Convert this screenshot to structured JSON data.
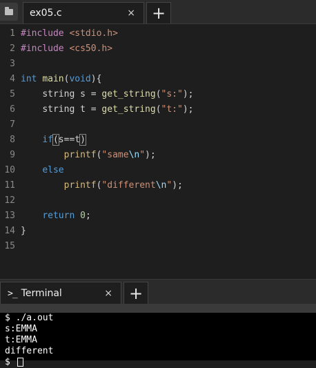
{
  "editor": {
    "tab_label": "ex05.c",
    "close_glyph": "×",
    "add_tab_glyph": "+"
  },
  "code_lines": [
    {
      "n": "1"
    },
    {
      "n": "2"
    },
    {
      "n": "3"
    },
    {
      "n": "4"
    },
    {
      "n": "5"
    },
    {
      "n": "6"
    },
    {
      "n": "7"
    },
    {
      "n": "8"
    },
    {
      "n": "9"
    },
    {
      "n": "10"
    },
    {
      "n": "11"
    },
    {
      "n": "12"
    },
    {
      "n": "13"
    },
    {
      "n": "14"
    },
    {
      "n": "15"
    }
  ],
  "code": {
    "l1_dir": "#include",
    "l1_hdr": "<stdio.h>",
    "l2_dir": "#include",
    "l2_hdr": "<cs50.h>",
    "l4_type": "int",
    "l4_fn": "main",
    "l4_param": "void",
    "l5_type": "string",
    "l5_var": "s",
    "l5_fn": "get_string",
    "l5_str": "\"s:\"",
    "l6_type": "string",
    "l6_var": "t",
    "l6_fn": "get_string",
    "l6_str": "\"t:\"",
    "l8_kw": "if",
    "l8_a": "s",
    "l8_op": "==",
    "l8_b": "t",
    "l9_fn": "printf",
    "l9_str1": "\"same",
    "l9_esc": "\\n",
    "l9_str2": "\"",
    "l10_kw": "else",
    "l11_fn": "printf",
    "l11_str1": "\"different",
    "l11_esc": "\\n",
    "l11_str2": "\"",
    "l13_kw": "return",
    "l13_num": "0"
  },
  "terminal": {
    "tab_label": "Terminal",
    "prompt_glyph": ">_",
    "close_glyph": "×",
    "add_tab_glyph": "+",
    "lines": [
      "$ ./a.out",
      "s:EMMA",
      "t:EMMA",
      "different",
      "$ "
    ]
  },
  "colors": {
    "background": "#1e1e1e",
    "keyword": "#569cd6",
    "preprocessor": "#c586c0",
    "string": "#ce9178",
    "function": "#dcdcaa",
    "terminal_bg": "#000000"
  },
  "icons": {
    "folder": "folder-icon",
    "close": "close-icon",
    "add": "plus-icon",
    "terminal": "terminal-prompt-icon"
  }
}
